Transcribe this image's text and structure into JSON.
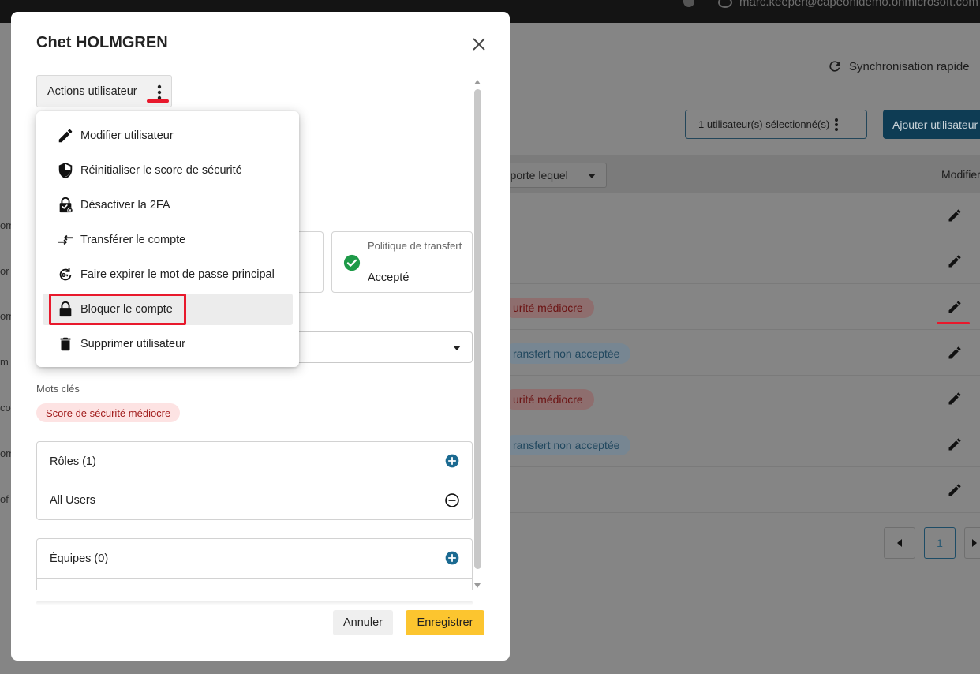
{
  "topbar": {
    "user_email": "marc.keeper@capeonidemo.onmicrosoft.com"
  },
  "background": {
    "sync_label": "Synchronisation rapide",
    "selected_label": "1 utilisateur(s) sélectionné(s)",
    "add_user_label": "Ajouter utilisateur",
    "filter_label": "N'importe lequel",
    "column_modify": "Modifier",
    "left_fragments": [
      "om",
      "or",
      "om",
      "m",
      "co",
      "om",
      "of"
    ],
    "rows": [
      {
        "status": ""
      },
      {
        "status": ""
      },
      {
        "status": "Score de sécurité médiocre",
        "type": "red"
      },
      {
        "status": "Politique de transfert non acceptée",
        "type": "blue"
      },
      {
        "status": "Score de sécurité médiocre",
        "type": "red"
      },
      {
        "status": "Politique de transfert non acceptée",
        "type": "blue"
      },
      {
        "status": ""
      }
    ],
    "row_status_visible": [
      "urité médiocre",
      "ransfert non acceptée",
      "urité médiocre",
      "ransfert non acceptée"
    ],
    "current_page": "1"
  },
  "modal": {
    "title": "Chet HOLMGREN",
    "actions_label": "Actions utilisateur",
    "policy": {
      "label": "Politique de transfert",
      "value": "Accepté"
    },
    "tags_label": "Mots clés",
    "tag": "Score de sécurité médiocre",
    "roles_header": "Rôles (1)",
    "role_item": "All Users",
    "teams_header": "Équipes (0)",
    "cancel_label": "Annuler",
    "save_label": "Enregistrer"
  },
  "menu": {
    "items": [
      {
        "label": "Modifier utilisateur",
        "icon": "pencil-icon"
      },
      {
        "label": "Réinitialiser le score de sécurité",
        "icon": "shield-icon"
      },
      {
        "label": "Désactiver la 2FA",
        "icon": "lock-badge-icon"
      },
      {
        "label": "Transférer le compte",
        "icon": "transfer-arrows-icon"
      },
      {
        "label": "Faire expirer le mot de passe principal",
        "icon": "key-reset-icon"
      },
      {
        "label": "Bloquer le compte",
        "icon": "lock-icon"
      },
      {
        "label": "Supprimer utilisateur",
        "icon": "trash-icon"
      }
    ]
  },
  "colors": {
    "accent_yellow": "#fcc52f",
    "primary_blue": "#1b6a91",
    "highlight_red": "#e8192c",
    "success_green": "#1e9a48"
  }
}
